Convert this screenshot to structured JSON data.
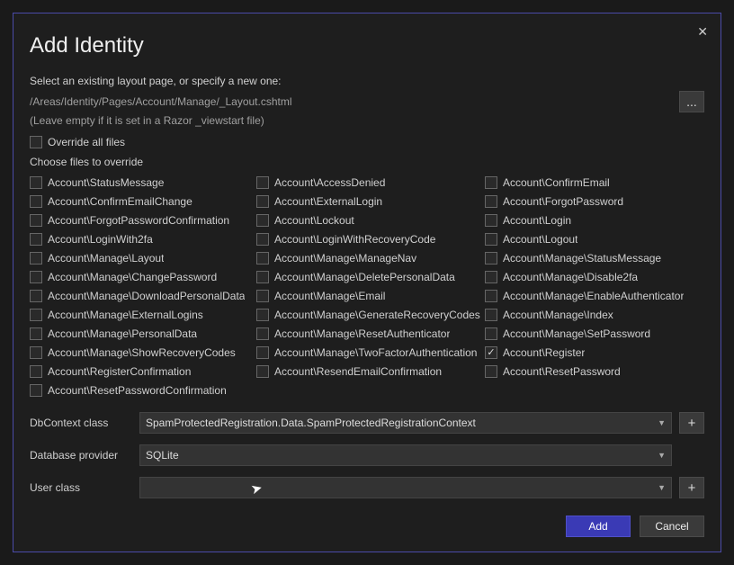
{
  "title": "Add Identity",
  "intro": "Select an existing layout page, or specify a new one:",
  "layout_path": "/Areas/Identity/Pages/Account/Manage/_Layout.cshtml",
  "layout_hint": "(Leave empty if it is set in a Razor _viewstart file)",
  "browse_label": "...",
  "override_label": "Override all files",
  "override_checked": false,
  "choose_label": "Choose files to override",
  "files_col1": [
    {
      "label": "Account\\StatusMessage",
      "checked": false
    },
    {
      "label": "Account\\ConfirmEmailChange",
      "checked": false
    },
    {
      "label": "Account\\ForgotPasswordConfirmation",
      "checked": false
    },
    {
      "label": "Account\\LoginWith2fa",
      "checked": false
    },
    {
      "label": "Account\\Manage\\Layout",
      "checked": false
    },
    {
      "label": "Account\\Manage\\ChangePassword",
      "checked": false
    },
    {
      "label": "Account\\Manage\\DownloadPersonalData",
      "checked": false
    },
    {
      "label": "Account\\Manage\\ExternalLogins",
      "checked": false
    },
    {
      "label": "Account\\Manage\\PersonalData",
      "checked": false
    },
    {
      "label": "Account\\Manage\\ShowRecoveryCodes",
      "checked": false
    },
    {
      "label": "Account\\RegisterConfirmation",
      "checked": false
    },
    {
      "label": "Account\\ResetPasswordConfirmation",
      "checked": false
    }
  ],
  "files_col2": [
    {
      "label": "Account\\AccessDenied",
      "checked": false
    },
    {
      "label": "Account\\ExternalLogin",
      "checked": false
    },
    {
      "label": "Account\\Lockout",
      "checked": false
    },
    {
      "label": "Account\\LoginWithRecoveryCode",
      "checked": false
    },
    {
      "label": "Account\\Manage\\ManageNav",
      "checked": false
    },
    {
      "label": "Account\\Manage\\DeletePersonalData",
      "checked": false
    },
    {
      "label": "Account\\Manage\\Email",
      "checked": false
    },
    {
      "label": "Account\\Manage\\GenerateRecoveryCodes",
      "checked": false
    },
    {
      "label": "Account\\Manage\\ResetAuthenticator",
      "checked": false
    },
    {
      "label": "Account\\Manage\\TwoFactorAuthentication",
      "checked": false
    },
    {
      "label": "Account\\ResendEmailConfirmation",
      "checked": false
    }
  ],
  "files_col3": [
    {
      "label": "Account\\ConfirmEmail",
      "checked": false
    },
    {
      "label": "Account\\ForgotPassword",
      "checked": false
    },
    {
      "label": "Account\\Login",
      "checked": false
    },
    {
      "label": "Account\\Logout",
      "checked": false
    },
    {
      "label": "Account\\Manage\\StatusMessage",
      "checked": false
    },
    {
      "label": "Account\\Manage\\Disable2fa",
      "checked": false
    },
    {
      "label": "Account\\Manage\\EnableAuthenticator",
      "checked": false
    },
    {
      "label": "Account\\Manage\\Index",
      "checked": false
    },
    {
      "label": "Account\\Manage\\SetPassword",
      "checked": false
    },
    {
      "label": "Account\\Register",
      "checked": true
    },
    {
      "label": "Account\\ResetPassword",
      "checked": false
    }
  ],
  "form": {
    "dbcontext_label": "DbContext class",
    "dbcontext_value": "SpamProtectedRegistration.Data.SpamProtectedRegistrationContext",
    "dbprovider_label": "Database provider",
    "dbprovider_value": "SQLite",
    "userclass_label": "User class",
    "userclass_value": ""
  },
  "buttons": {
    "add": "Add",
    "cancel": "Cancel",
    "plus": "+"
  }
}
